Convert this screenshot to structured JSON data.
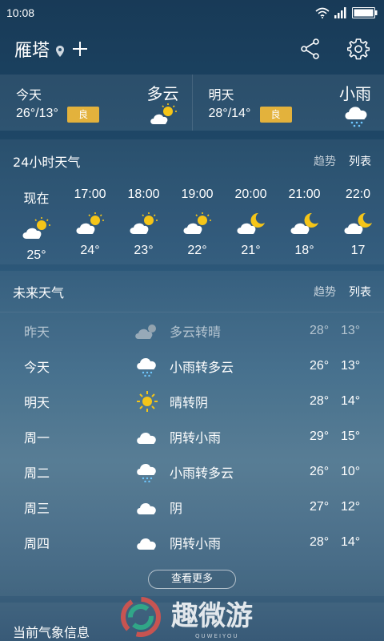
{
  "status": {
    "time": "10:08"
  },
  "header": {
    "city": "雁塔"
  },
  "today": {
    "label": "今天",
    "temp": "26°/13°",
    "aqi": "良",
    "condition": "多云"
  },
  "tomorrow": {
    "label": "明天",
    "temp": "28°/14°",
    "aqi": "良",
    "condition": "小雨"
  },
  "hourly": {
    "title": "24小时天气",
    "tab_trend": "趋势",
    "tab_list": "列表",
    "items": [
      {
        "time": "现在",
        "temp": "25°",
        "icon": "partly-sunny-icon"
      },
      {
        "time": "17:00",
        "temp": "24°",
        "icon": "partly-sunny-icon"
      },
      {
        "time": "18:00",
        "temp": "23°",
        "icon": "partly-sunny-icon"
      },
      {
        "time": "19:00",
        "temp": "22°",
        "icon": "partly-sunny-icon"
      },
      {
        "time": "20:00",
        "temp": "21°",
        "icon": "partly-moon-icon"
      },
      {
        "time": "21:00",
        "temp": "18°",
        "icon": "partly-moon-icon"
      },
      {
        "time": "22:0",
        "temp": "17",
        "icon": "partly-moon-icon"
      }
    ]
  },
  "forecast": {
    "title": "未来天气",
    "tab_trend": "趋势",
    "tab_list": "列表",
    "rows": [
      {
        "day": "昨天",
        "cond": "多云转晴",
        "high": "28°",
        "low": "13°",
        "icon": "partly-sunny-icon"
      },
      {
        "day": "今天",
        "cond": "小雨转多云",
        "high": "26°",
        "low": "13°",
        "icon": "rain-cloud-icon"
      },
      {
        "day": "明天",
        "cond": "晴转阴",
        "high": "28°",
        "low": "14°",
        "icon": "sun-icon"
      },
      {
        "day": "周一",
        "cond": "阴转小雨",
        "high": "29°",
        "low": "15°",
        "icon": "cloud-icon"
      },
      {
        "day": "周二",
        "cond": "小雨转多云",
        "high": "26°",
        "low": "10°",
        "icon": "rain-cloud-icon"
      },
      {
        "day": "周三",
        "cond": "阴",
        "high": "27°",
        "low": "12°",
        "icon": "cloud-icon"
      },
      {
        "day": "周四",
        "cond": "阴转小雨",
        "high": "28°",
        "low": "14°",
        "icon": "cloud-icon"
      }
    ],
    "more_label": "查看更多"
  },
  "bottom": {
    "title": "当前气象信息"
  },
  "watermark": {
    "text": "趣微游",
    "sub": "QUWEIYOU"
  },
  "colors": {
    "aqi_good": "#e3b23c",
    "sun": "#f5c518",
    "moon": "#f5c518"
  }
}
